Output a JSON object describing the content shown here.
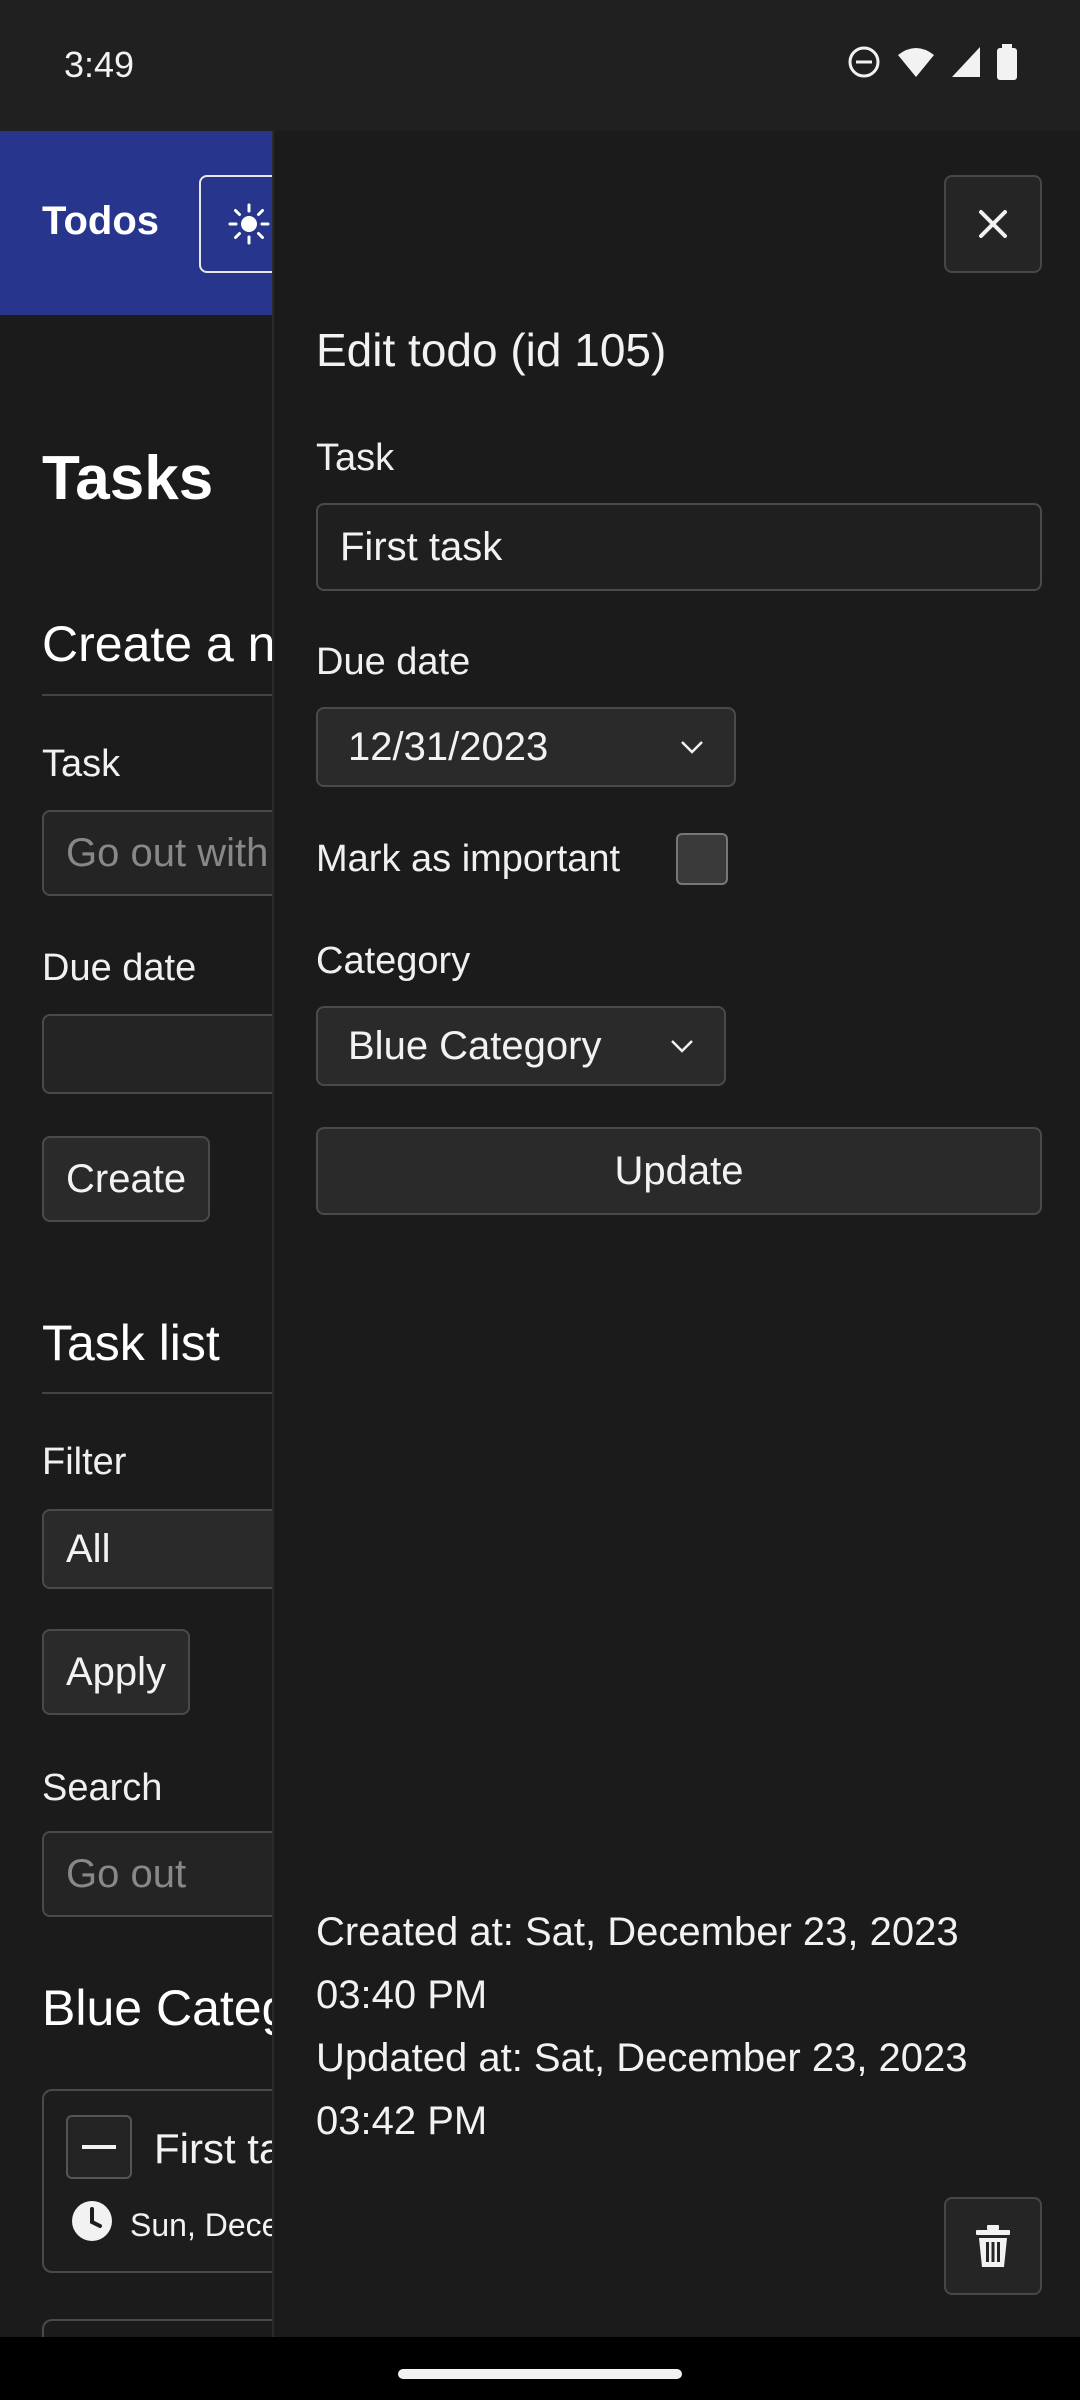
{
  "status_bar": {
    "time": "3:49",
    "icons": [
      "do-not-disturb-icon",
      "wifi-icon",
      "signal-icon",
      "battery-icon"
    ]
  },
  "app": {
    "brand": "Todos",
    "accent_color": "#27368c"
  },
  "background_page": {
    "heading": "Tasks",
    "create_section_title": "Create a n",
    "task_label": "Task",
    "task_placeholder": "Go out with",
    "due_date_label": "Due date",
    "create_button": "Create",
    "task_list_title": "Task list",
    "filter_label": "Filter",
    "filter_value": "All",
    "apply_button": "Apply",
    "search_label": "Search",
    "search_placeholder": "Go out",
    "category_heading": "Blue Categ",
    "card": {
      "title": "First ta",
      "due": "Sun, Dece"
    }
  },
  "drawer": {
    "title": "Edit todo (id 105)",
    "task_label": "Task",
    "task_value": "First task",
    "due_date_label": "Due date",
    "due_date_value": "12/31/2023",
    "important_label": "Mark as important",
    "important_checked": false,
    "category_label": "Category",
    "category_value": "Blue Category",
    "update_button": "Update",
    "created_at": "Created at: Sat, December 23, 2023 03:40 PM",
    "updated_at": "Updated at: Sat, December 23, 2023 03:42 PM"
  }
}
